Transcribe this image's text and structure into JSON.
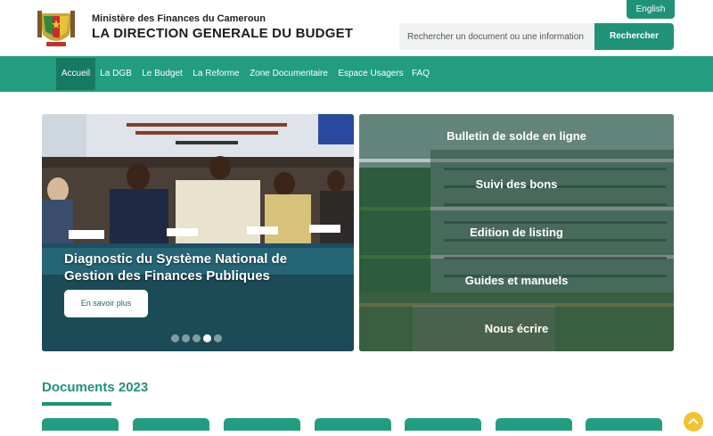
{
  "header": {
    "ministry": "Ministère des Finances du Cameroun",
    "title": "LA DIRECTION GENERALE DU BUDGET",
    "language_button": "English",
    "search_placeholder": "Rechercher un document ou une information",
    "search_button": "Rechercher"
  },
  "nav": {
    "items": [
      {
        "label": "Accueil"
      },
      {
        "label": "La DGB"
      },
      {
        "label": "Le Budget"
      },
      {
        "label": "La Reforme"
      },
      {
        "label": "Zone Documentaire"
      },
      {
        "label": "Espace Usagers"
      },
      {
        "label": "FAQ"
      }
    ],
    "active_index": 0
  },
  "hero": {
    "title": "Diagnostic du Système National de Gestion des Finances Publiques",
    "button": "En savoir plus",
    "slide_count": 5,
    "active_slide": 4
  },
  "quick_links": [
    {
      "label": "Bulletin de solde en ligne"
    },
    {
      "label": "Suivi des bons"
    },
    {
      "label": "Edition de listing"
    },
    {
      "label": "Guides et manuels"
    },
    {
      "label": "Nous écrire"
    }
  ],
  "documents": {
    "title": "Documents 2023"
  },
  "colors": {
    "accent": "#1f9277",
    "nav": "#229d80",
    "nav_active": "#167a63"
  }
}
